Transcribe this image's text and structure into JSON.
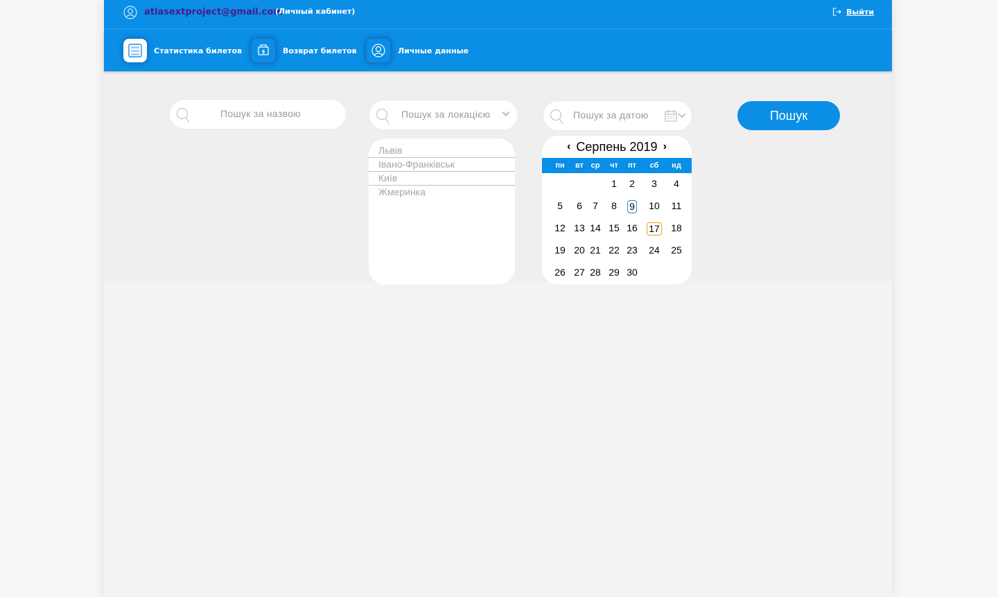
{
  "header": {
    "email": "atlasextproject@gmail.com",
    "cabinet_label": "(Личный кабинет)",
    "logout_label": "Выйти"
  },
  "nav": {
    "items": [
      {
        "label": "Статистика билетов",
        "icon": "ticket-stats-icon",
        "active": true
      },
      {
        "label": "Возврат билетов",
        "icon": "ticket-refund-icon",
        "active": false
      },
      {
        "label": "Личные данные",
        "icon": "user-icon",
        "active": false
      }
    ]
  },
  "search": {
    "name_placeholder": "Пошук за назвою",
    "location_placeholder": "Пошук за локацією",
    "date_placeholder": "Пошук за датою",
    "button_label": "Пошук"
  },
  "locations": [
    "Львів",
    "Івано-Франківськ",
    "Київ",
    "Жмеринка"
  ],
  "calendar": {
    "month_label": "Серпень 2019",
    "weekdays": [
      "пн",
      "вт",
      "ср",
      "чт",
      "пт",
      "сб",
      "нд"
    ],
    "days": [
      [
        "",
        "",
        "",
        "1",
        "2",
        "3",
        "4"
      ],
      [
        "5",
        "6",
        "7",
        "8",
        "9",
        "10",
        "11"
      ],
      [
        "12",
        "13",
        "14",
        "15",
        "16",
        "17",
        "18"
      ],
      [
        "19",
        "20",
        "21",
        "22",
        "23",
        "24",
        "25"
      ],
      [
        "26",
        "27",
        "28",
        "29",
        "30",
        "",
        ""
      ]
    ],
    "today": "9",
    "selected": "17",
    "today_color": "#1e88e5",
    "selected_color": "#f39c12"
  },
  "colors": {
    "brand_blue": "#0a8ee6",
    "email_purple": "#4b1c8a"
  }
}
